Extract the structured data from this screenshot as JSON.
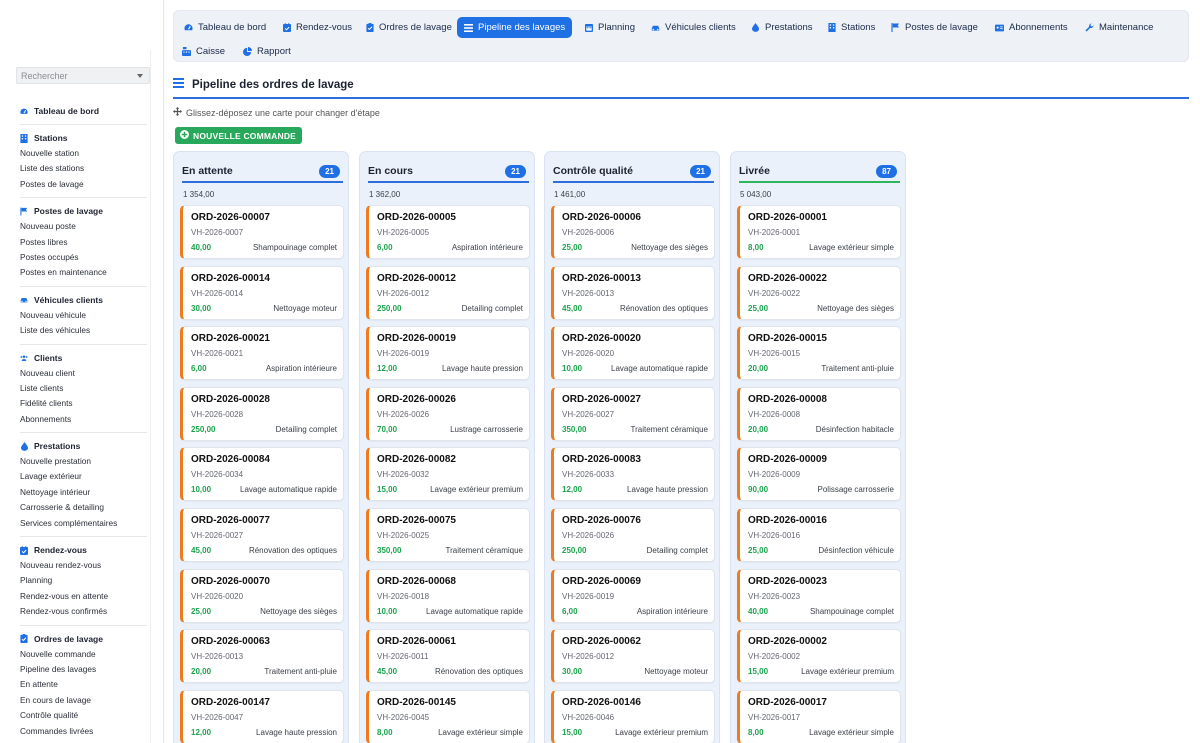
{
  "sidebar": {
    "search_placeholder": "Rechercher",
    "groups": [
      {
        "title": "Tableau de bord",
        "icon": "gauge-icon",
        "items": []
      },
      {
        "title": "Stations",
        "icon": "building-icon",
        "items": [
          "Nouvelle station",
          "Liste des stations",
          "Postes de lavage"
        ]
      },
      {
        "title": "Postes de lavage",
        "icon": "flag-icon",
        "items": [
          "Nouveau poste",
          "Postes libres",
          "Postes occupés",
          "Postes en maintenance"
        ]
      },
      {
        "title": "Véhicules clients",
        "icon": "car-icon",
        "items": [
          "Nouveau véhicule",
          "Liste des véhicules"
        ]
      },
      {
        "title": "Clients",
        "icon": "users-icon",
        "items": [
          "Nouveau client",
          "Liste clients",
          "Fidélité clients",
          "Abonnements"
        ]
      },
      {
        "title": "Prestations",
        "icon": "droplet-icon",
        "items": [
          "Nouvelle prestation",
          "Lavage extérieur",
          "Nettoyage intérieur",
          "Carrosserie & detailing",
          "Services complémentaires"
        ]
      },
      {
        "title": "Rendez-vous",
        "icon": "calendar-check-icon",
        "items": [
          "Nouveau rendez-vous",
          "Planning",
          "Rendez-vous en attente",
          "Rendez-vous confirmés"
        ]
      },
      {
        "title": "Ordres de lavage",
        "icon": "clipboard-icon",
        "items": [
          "Nouvelle commande",
          "Pipeline des lavages",
          "En attente",
          "En cours de lavage",
          "Contrôle qualité",
          "Commandes livrées"
        ]
      }
    ]
  },
  "topnav": {
    "tabs": [
      {
        "label": "Tableau de bord",
        "icon": "gauge-icon",
        "active": false
      },
      {
        "label": "Rendez-vous",
        "icon": "calendar-check-icon",
        "active": false
      },
      {
        "label": "Ordres de lavage",
        "icon": "clipboard-icon",
        "active": false
      },
      {
        "label": "Pipeline des lavages",
        "icon": "bars-icon",
        "active": true
      },
      {
        "label": "Planning",
        "icon": "calendar-icon",
        "active": false
      },
      {
        "label": "Véhicules clients",
        "icon": "car-icon",
        "active": false
      },
      {
        "label": "Prestations",
        "icon": "droplet-icon",
        "active": false
      },
      {
        "label": "Stations",
        "icon": "building-icon",
        "active": false
      },
      {
        "label": "Postes de lavage",
        "icon": "flag-icon",
        "active": false
      },
      {
        "label": "Abonnements",
        "icon": "id-card-icon",
        "active": false
      },
      {
        "label": "Maintenance",
        "icon": "wrench-icon",
        "active": false
      },
      {
        "label": "Caisse",
        "icon": "cash-register-icon",
        "active": false
      },
      {
        "label": "Rapport",
        "icon": "pie-chart-icon",
        "active": false
      }
    ]
  },
  "page": {
    "title": "Pipeline des ordres de lavage",
    "hint": "Glissez-déposez une carte pour changer d'étape",
    "new_button": "NOUVELLE COMMANDE"
  },
  "colors": {
    "accent": "#1f6fe5",
    "success": "#27a85a",
    "card_border": "#ef7b1f",
    "column_bg": "#eaf1fb"
  },
  "columns": [
    {
      "title": "En attente",
      "count": "21",
      "total": "1 354,00",
      "rule": "blue",
      "cards": [
        {
          "id": "ORD-2026-00007",
          "vehicle": "VH-2026-0007",
          "price": "40,00",
          "service": "Shampouinage complet"
        },
        {
          "id": "ORD-2026-00014",
          "vehicle": "VH-2026-0014",
          "price": "30,00",
          "service": "Nettoyage moteur"
        },
        {
          "id": "ORD-2026-00021",
          "vehicle": "VH-2026-0021",
          "price": "6,00",
          "service": "Aspiration intérieure"
        },
        {
          "id": "ORD-2026-00028",
          "vehicle": "VH-2026-0028",
          "price": "250,00",
          "service": "Detailing complet"
        },
        {
          "id": "ORD-2026-00084",
          "vehicle": "VH-2026-0034",
          "price": "10,00",
          "service": "Lavage automatique rapide"
        },
        {
          "id": "ORD-2026-00077",
          "vehicle": "VH-2026-0027",
          "price": "45,00",
          "service": "Rénovation des optiques"
        },
        {
          "id": "ORD-2026-00070",
          "vehicle": "VH-2026-0020",
          "price": "25,00",
          "service": "Nettoyage des sièges"
        },
        {
          "id": "ORD-2026-00063",
          "vehicle": "VH-2026-0013",
          "price": "20,00",
          "service": "Traitement anti-pluie"
        },
        {
          "id": "ORD-2026-00147",
          "vehicle": "VH-2026-0047",
          "price": "12,00",
          "service": "Lavage haute pression"
        }
      ]
    },
    {
      "title": "En cours",
      "count": "21",
      "total": "1 362,00",
      "rule": "blue",
      "cards": [
        {
          "id": "ORD-2026-00005",
          "vehicle": "VH-2026-0005",
          "price": "6,00",
          "service": "Aspiration intérieure"
        },
        {
          "id": "ORD-2026-00012",
          "vehicle": "VH-2026-0012",
          "price": "250,00",
          "service": "Detailing complet"
        },
        {
          "id": "ORD-2026-00019",
          "vehicle": "VH-2026-0019",
          "price": "12,00",
          "service": "Lavage haute pression"
        },
        {
          "id": "ORD-2026-00026",
          "vehicle": "VH-2026-0026",
          "price": "70,00",
          "service": "Lustrage carrosserie"
        },
        {
          "id": "ORD-2026-00082",
          "vehicle": "VH-2026-0032",
          "price": "15,00",
          "service": "Lavage extérieur premium"
        },
        {
          "id": "ORD-2026-00075",
          "vehicle": "VH-2026-0025",
          "price": "350,00",
          "service": "Traitement céramique"
        },
        {
          "id": "ORD-2026-00068",
          "vehicle": "VH-2026-0018",
          "price": "10,00",
          "service": "Lavage automatique rapide"
        },
        {
          "id": "ORD-2026-00061",
          "vehicle": "VH-2026-0011",
          "price": "45,00",
          "service": "Rénovation des optiques"
        },
        {
          "id": "ORD-2026-00145",
          "vehicle": "VH-2026-0045",
          "price": "8,00",
          "service": "Lavage extérieur simple"
        }
      ]
    },
    {
      "title": "Contrôle qualité",
      "count": "21",
      "total": "1 461,00",
      "rule": "blue",
      "cards": [
        {
          "id": "ORD-2026-00006",
          "vehicle": "VH-2026-0006",
          "price": "25,00",
          "service": "Nettoyage des sièges"
        },
        {
          "id": "ORD-2026-00013",
          "vehicle": "VH-2026-0013",
          "price": "45,00",
          "service": "Rénovation des optiques"
        },
        {
          "id": "ORD-2026-00020",
          "vehicle": "VH-2026-0020",
          "price": "10,00",
          "service": "Lavage automatique rapide"
        },
        {
          "id": "ORD-2026-00027",
          "vehicle": "VH-2026-0027",
          "price": "350,00",
          "service": "Traitement céramique"
        },
        {
          "id": "ORD-2026-00083",
          "vehicle": "VH-2026-0033",
          "price": "12,00",
          "service": "Lavage haute pression"
        },
        {
          "id": "ORD-2026-00076",
          "vehicle": "VH-2026-0026",
          "price": "250,00",
          "service": "Detailing complet"
        },
        {
          "id": "ORD-2026-00069",
          "vehicle": "VH-2026-0019",
          "price": "6,00",
          "service": "Aspiration intérieure"
        },
        {
          "id": "ORD-2026-00062",
          "vehicle": "VH-2026-0012",
          "price": "30,00",
          "service": "Nettoyage moteur"
        },
        {
          "id": "ORD-2026-00146",
          "vehicle": "VH-2026-0046",
          "price": "15,00",
          "service": "Lavage extérieur premium"
        }
      ]
    },
    {
      "title": "Livrée",
      "count": "87",
      "total": "5 043,00",
      "rule": "green",
      "cards": [
        {
          "id": "ORD-2026-00001",
          "vehicle": "VH-2026-0001",
          "price": "8,00",
          "service": "Lavage extérieur simple"
        },
        {
          "id": "ORD-2026-00022",
          "vehicle": "VH-2026-0022",
          "price": "25,00",
          "service": "Nettoyage des sièges"
        },
        {
          "id": "ORD-2026-00015",
          "vehicle": "VH-2026-0015",
          "price": "20,00",
          "service": "Traitement anti-pluie"
        },
        {
          "id": "ORD-2026-00008",
          "vehicle": "VH-2026-0008",
          "price": "20,00",
          "service": "Désinfection habitacle"
        },
        {
          "id": "ORD-2026-00009",
          "vehicle": "VH-2026-0009",
          "price": "90,00",
          "service": "Polissage carrosserie"
        },
        {
          "id": "ORD-2026-00016",
          "vehicle": "VH-2026-0016",
          "price": "25,00",
          "service": "Désinfection véhicule"
        },
        {
          "id": "ORD-2026-00023",
          "vehicle": "VH-2026-0023",
          "price": "40,00",
          "service": "Shampouinage complet"
        },
        {
          "id": "ORD-2026-00002",
          "vehicle": "VH-2026-0002",
          "price": "15,00",
          "service": "Lavage extérieur premium"
        },
        {
          "id": "ORD-2026-00017",
          "vehicle": "VH-2026-0017",
          "price": "8,00",
          "service": "Lavage extérieur simple"
        }
      ]
    }
  ]
}
